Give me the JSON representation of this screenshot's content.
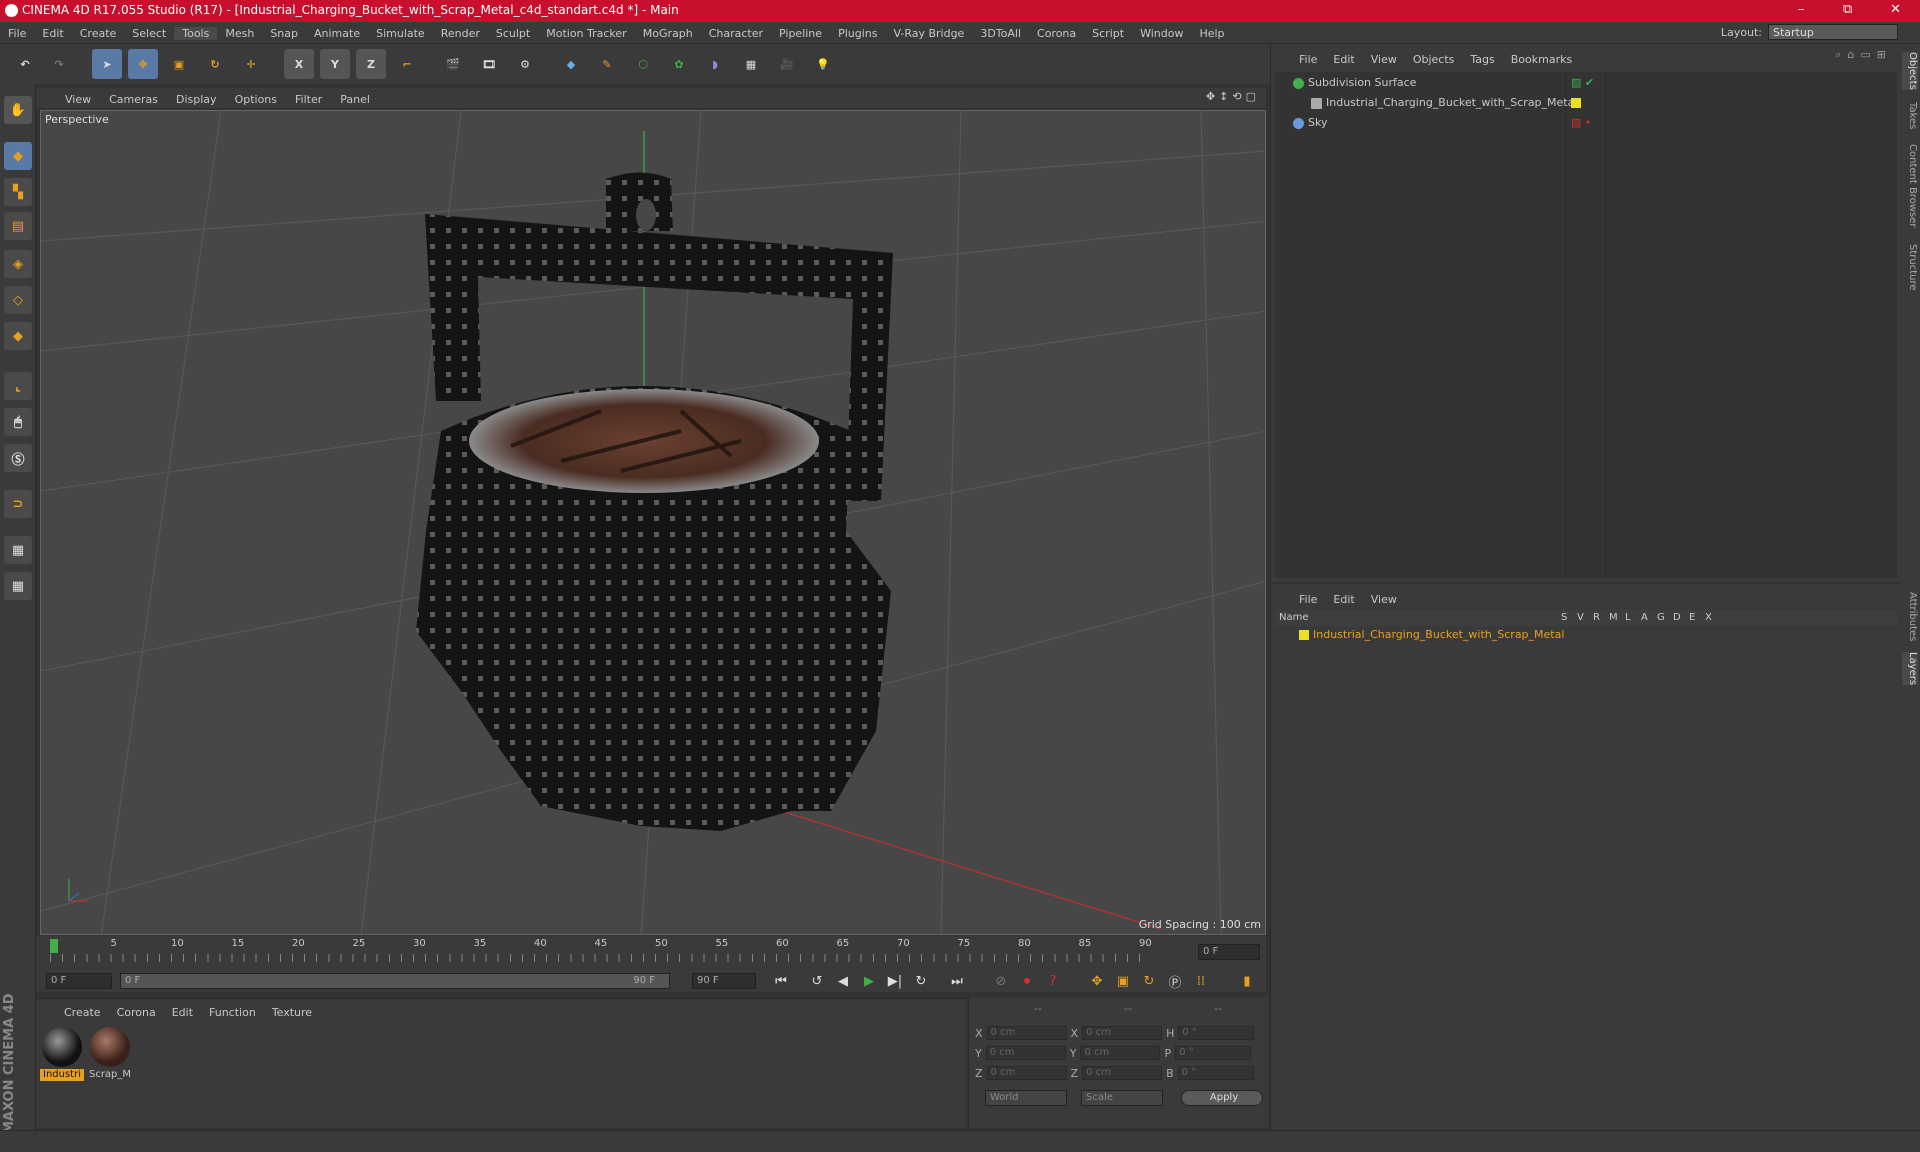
{
  "window": {
    "title": "CINEMA 4D R17.055 Studio (R17) - [Industrial_Charging_Bucket_with_Scrap_Metal_c4d_standart.c4d *] - Main",
    "minimize": "–",
    "maximize": "⧉",
    "close": "✕"
  },
  "menubar": {
    "items": [
      "File",
      "Edit",
      "Create",
      "Select",
      "Tools",
      "Mesh",
      "Snap",
      "Animate",
      "Simulate",
      "Render",
      "Sculpt",
      "Motion Tracker",
      "MoGraph",
      "Character",
      "Pipeline",
      "Plugins",
      "V-Ray Bridge",
      "3DToAll",
      "Corona",
      "Script",
      "Window",
      "Help"
    ],
    "active": "Tools",
    "layout_label": "Layout:",
    "layout_value": "Startup"
  },
  "toolbar": {
    "axis_x": "X",
    "axis_y": "Y",
    "axis_z": "Z"
  },
  "viewport": {
    "menu": [
      "View",
      "Cameras",
      "Display",
      "Options",
      "Filter",
      "Panel"
    ],
    "label": "Perspective",
    "grid_spacing": "Grid Spacing : 100 cm"
  },
  "timeline": {
    "ticks": [
      "0",
      "5",
      "10",
      "15",
      "20",
      "25",
      "30",
      "35",
      "40",
      "45",
      "50",
      "55",
      "60",
      "65",
      "70",
      "75",
      "80",
      "85",
      "90"
    ],
    "current_frame": "0 F",
    "start_field": "0 F",
    "range_start": "0 F",
    "range_end": "90 F",
    "end_field": "90 F"
  },
  "material_panel": {
    "menu": [
      "Create",
      "Corona",
      "Edit",
      "Function",
      "Texture"
    ],
    "materials": [
      {
        "label": "Industri",
        "selected": true
      },
      {
        "label": "Scrap_M",
        "selected": false
      }
    ]
  },
  "coord_panel": {
    "headers": [
      "--",
      "--",
      "--"
    ],
    "rows": [
      {
        "a": "X",
        "av": "0 cm",
        "b": "X",
        "bv": "0 cm",
        "c": "H",
        "cv": "0 °"
      },
      {
        "a": "Y",
        "av": "0 cm",
        "b": "Y",
        "bv": "0 cm",
        "c": "P",
        "cv": "0 °"
      },
      {
        "a": "Z",
        "av": "0 cm",
        "b": "Z",
        "bv": "0 cm",
        "c": "B",
        "cv": "0 °"
      }
    ],
    "world": "World",
    "scale": "Scale",
    "apply": "Apply"
  },
  "object_manager": {
    "menu": [
      "File",
      "Edit",
      "View",
      "Objects",
      "Tags",
      "Bookmarks"
    ],
    "objects": [
      {
        "name": "Subdivision Surface",
        "color": "#3fb04a"
      },
      {
        "name": "Industrial_Charging_Bucket_with_Scrap_Metal",
        "color": "#aaaaaa"
      },
      {
        "name": "Sky",
        "color": "#6a9ad8"
      }
    ]
  },
  "layer_manager": {
    "menu": [
      "File",
      "Edit",
      "View"
    ],
    "columns": [
      "Name",
      "S",
      "V",
      "R",
      "M",
      "L",
      "A",
      "G",
      "D",
      "E",
      "X"
    ],
    "layer_name": "Industrial_Charging_Bucket_with_Scrap_Metal"
  },
  "right_tabs": [
    "Objects",
    "Takes",
    "Content Browser",
    "Structure",
    "Attributes",
    "Layers"
  ],
  "colors": {
    "titlebar": "#c8102e",
    "accent": "#e8a020",
    "selection": "#5a7aa6"
  }
}
